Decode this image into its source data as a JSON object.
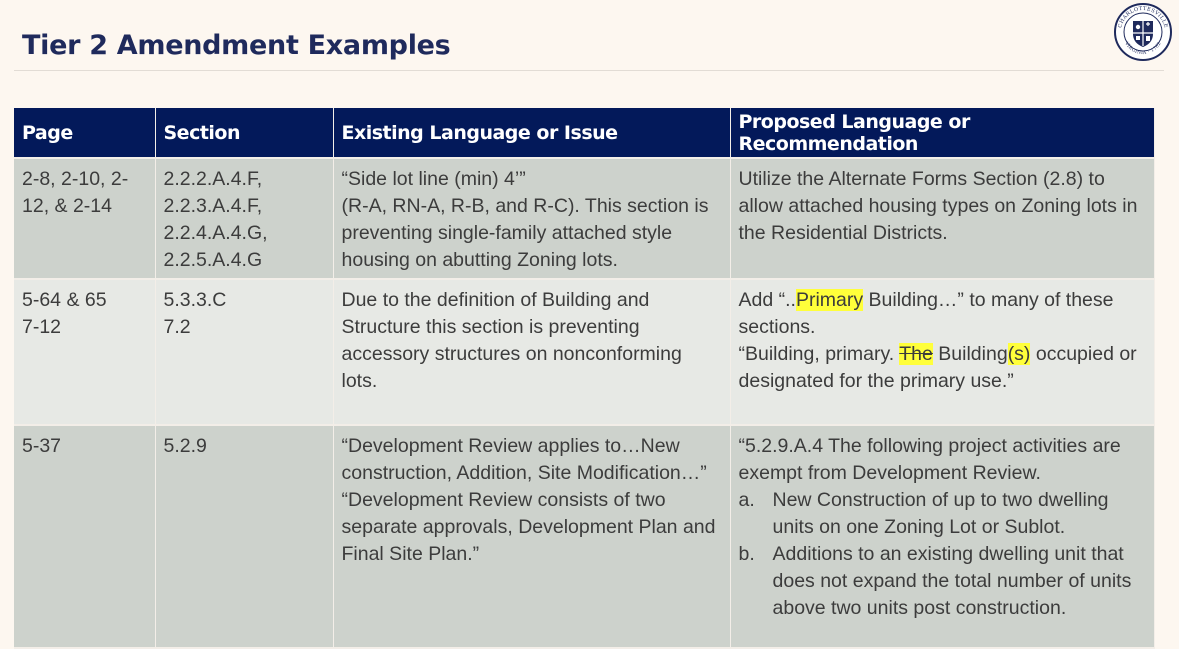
{
  "title": "Tier 2 Amendment Examples",
  "seal": {
    "top_text": "CHARLOTTESVILLE",
    "bottom_text": "VIRGINIA · 1762",
    "colors": {
      "navy": "#1f2a5c",
      "white": "#ffffff"
    }
  },
  "table": {
    "headers": [
      "Page",
      "Section",
      "Existing Language or Issue",
      "Proposed Language or Recommendation"
    ],
    "rows": [
      {
        "page": "2-8, 2-10, 2-12, & 2-14",
        "section": [
          "2.2.2.A.4.F,",
          "2.2.3.A.4.F,",
          "2.2.4.A.4.G,",
          "2.2.5.A.4.G"
        ],
        "existing": [
          "“Side lot line (min) 4’”",
          "(R-A, RN-A, R-B, and R-C). This section is preventing single-family attached style housing on abutting Zoning lots."
        ],
        "proposed": "Utilize the Alternate Forms Section (2.8) to allow attached housing types on Zoning lots in the Residential Districts."
      },
      {
        "page": [
          "5-64 & 65",
          "7-12"
        ],
        "section": [
          "5.3.3.C",
          "7.2"
        ],
        "existing": "Due to the definition of Building and Structure this section is preventing accessory structures on nonconforming lots.",
        "proposed": {
          "p1_before": "Add “..",
          "p1_highlight": "Primary",
          "p1_after": " Building…” to many of these sections.",
          "p2_before": "“Building, primary. ",
          "p2_strike": "The",
          "p2_mid": " Building",
          "p2_highlight": "(s)",
          "p2_after": " occupied or designated for the primary use.”"
        }
      },
      {
        "page": "5-37",
        "section": "5.2.9",
        "existing": [
          "“Development Review applies to…New construction, Addition, Site Modification…”",
          "“Development Review consists of two separate approvals, Development Plan and Final Site Plan.”"
        ],
        "proposed": {
          "intro": "“5.2.9.A.4 The following project activities are exempt from Development Review.",
          "items": [
            {
              "marker": "a.",
              "text": "New Construction of up to two dwelling units on one Zoning Lot or Sublot."
            },
            {
              "marker": "b.",
              "text": "Additions to an existing dwelling unit that does not expand the total number of units above two units post construction."
            }
          ]
        }
      }
    ]
  },
  "colors": {
    "header_bg": "#03195a",
    "row_dark": "#cdd2cc",
    "row_light": "#e7e9e5",
    "highlight": "#ffff3a",
    "title": "#1f2a5c"
  }
}
